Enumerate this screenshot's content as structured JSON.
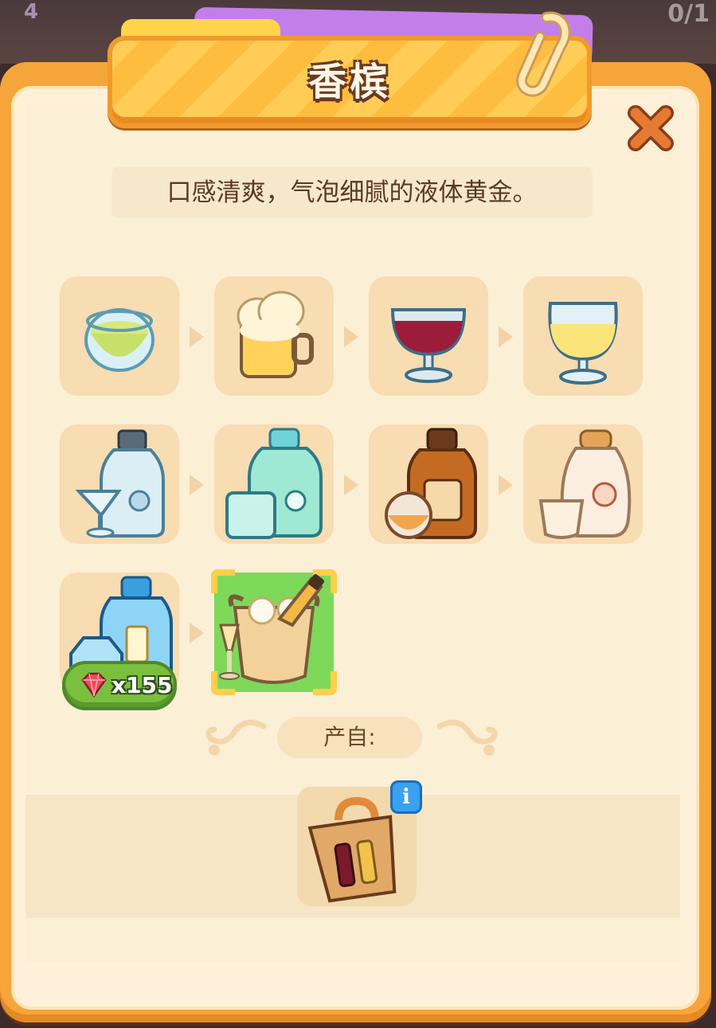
{
  "title": "香槟",
  "description": "口感清爽，气泡细腻的液体黄金。",
  "close_icon": "close-x-icon",
  "chain": [
    {
      "name": "green-tea-cup"
    },
    {
      "name": "beer-mug"
    },
    {
      "name": "red-wine-glass"
    },
    {
      "name": "white-wine-glass"
    },
    {
      "name": "vodka-bottle-cocktail-glass"
    },
    {
      "name": "green-bottle-glass"
    },
    {
      "name": "whiskey-bottle-glass"
    },
    {
      "name": "sake-bottle-cup"
    },
    {
      "name": "blue-gin-bottle"
    },
    {
      "name": "champagne-ice-bucket",
      "current": true
    }
  ],
  "price": {
    "icon": "ruby-gem-icon",
    "label": "x155"
  },
  "source": {
    "label": "产自:",
    "item_name": "wine-crate",
    "info_label": "i"
  },
  "colors": {
    "frame": "#f6a53a",
    "banner": "#ffc94e",
    "panel": "#fff1d9",
    "slot": "#f8dcb2",
    "current": "#7ed85a",
    "price": "#7bbf3e"
  },
  "background": {
    "left_text": "4",
    "right_text": "0/1"
  }
}
